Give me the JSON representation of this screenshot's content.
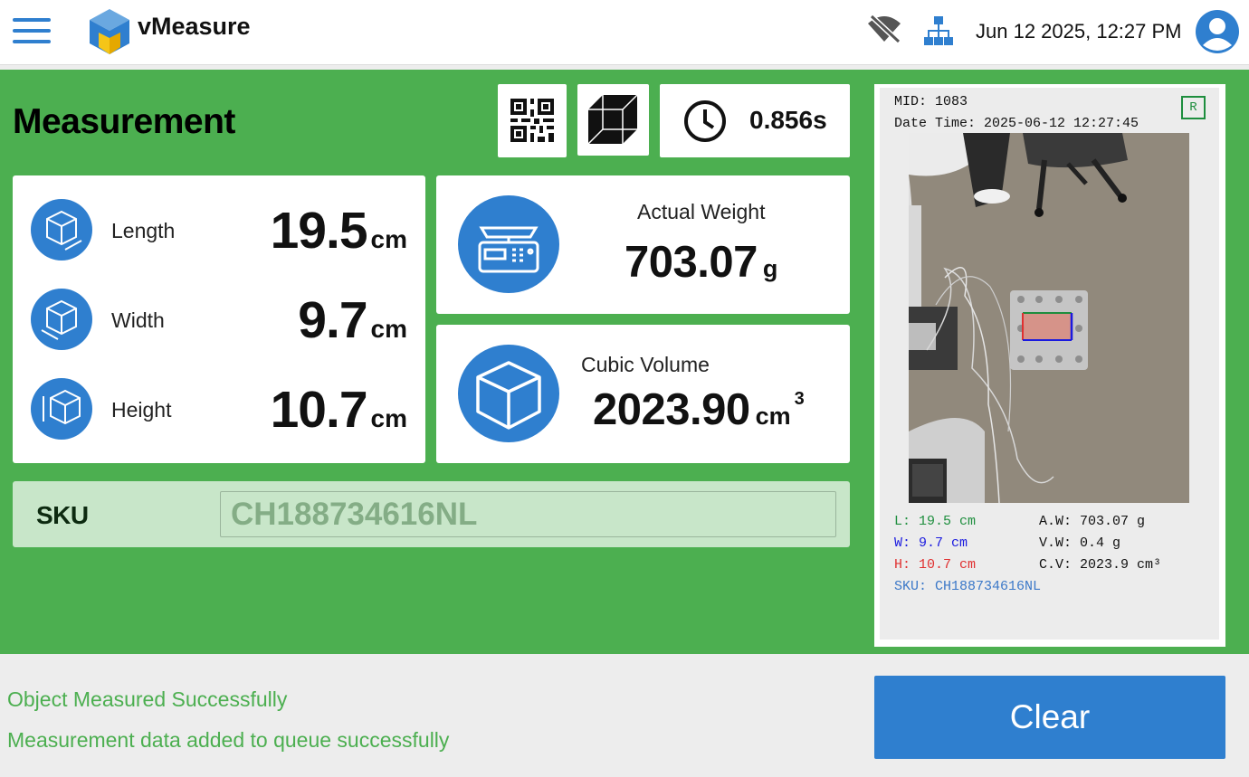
{
  "app": {
    "title": "vMeasure"
  },
  "header": {
    "datetime": "Jun 12 2025, 12:27 PM",
    "icons": [
      "menu-icon",
      "vmeasure-logo",
      "wifi-off-icon",
      "network-icon",
      "user-avatar-icon"
    ]
  },
  "measurement": {
    "heading": "Measurement",
    "timer": "0.856s",
    "length": {
      "label": "Length",
      "value": "19.5",
      "unit": "cm"
    },
    "width": {
      "label": "Width",
      "value": "9.7",
      "unit": "cm"
    },
    "height": {
      "label": "Height",
      "value": "10.7",
      "unit": "cm"
    },
    "weight": {
      "label": "Actual Weight",
      "value": "703.07",
      "unit": "g"
    },
    "volume": {
      "label": "Cubic Volume",
      "value": "2023.90",
      "unit": "cm",
      "exp": "3"
    }
  },
  "sku": {
    "label": "SKU",
    "value": "CH188734616NL"
  },
  "preview": {
    "mid": "MID: 1083",
    "datetime": "Date Time: 2025-06-12 12:27:45",
    "badge": "R",
    "l": "L: 19.5 cm",
    "w": "W: 9.7 cm",
    "h": "H: 10.7 cm",
    "aw": "A.W: 703.07 g",
    "vw": "V.W: 0.4 g",
    "cv": "C.V: 2023.9 cm³",
    "sku": "SKU: CH188734616NL"
  },
  "status": {
    "line1": "Object Measured Successfully",
    "line2": "Measurement data added to queue successfully"
  },
  "actions": {
    "clear": "Clear"
  },
  "colors": {
    "brand_blue": "#2f7fcf",
    "panel_green": "#4caf50",
    "sku_bg": "#c8e6c9",
    "preview_l": "#1e8e3e",
    "preview_w": "#1a1adf",
    "preview_h": "#e03030",
    "preview_sku": "#3b78c8"
  }
}
